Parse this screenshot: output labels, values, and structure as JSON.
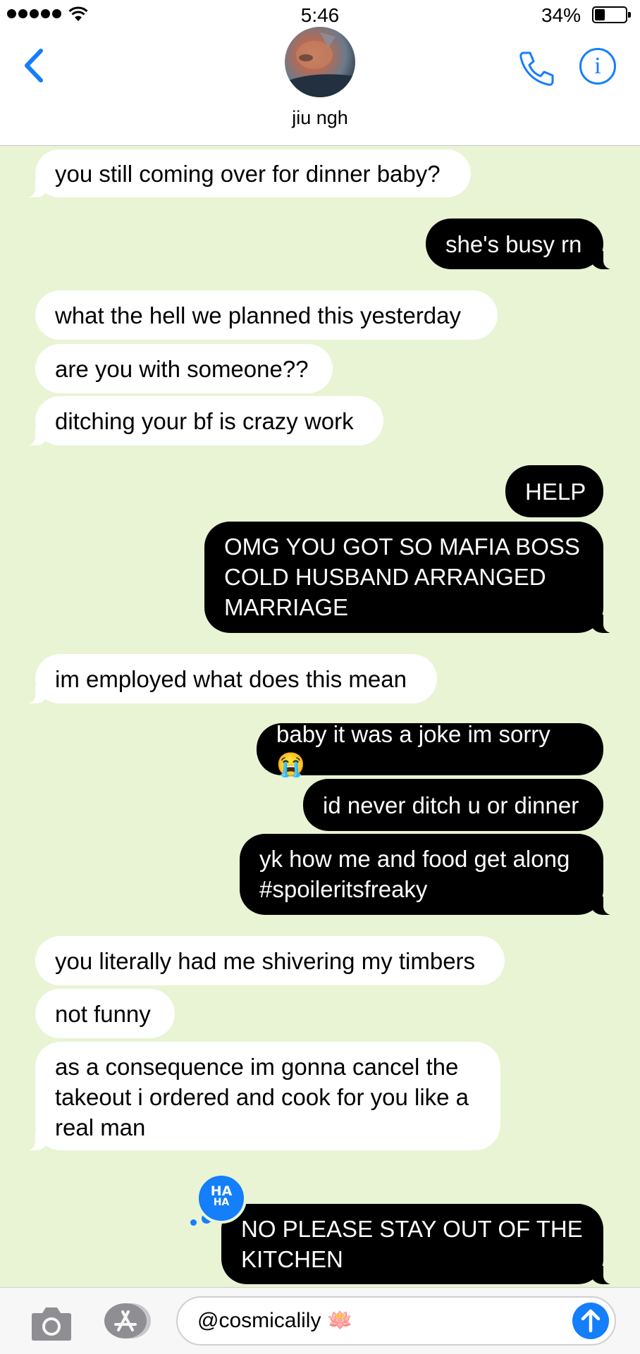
{
  "status_bar": {
    "time": "5:46",
    "battery_percent": "34%",
    "battery_level": 0.34,
    "signal_bars": 5
  },
  "header": {
    "contact_name": "jiu ngh",
    "back_icon": "chevron-left-icon",
    "call_icon": "phone-icon",
    "info_icon": "info-icon",
    "info_glyph": "i"
  },
  "messages": [
    {
      "side": "in",
      "text": "you still coming over for dinner baby?"
    },
    {
      "side": "out",
      "text": "she's busy rn"
    },
    {
      "side": "in",
      "text": "what the hell we planned this yesterday"
    },
    {
      "side": "in",
      "text": "are you with someone??"
    },
    {
      "side": "in",
      "text": "ditching your bf is crazy work"
    },
    {
      "side": "out",
      "text": "HELP"
    },
    {
      "side": "out",
      "text": "OMG YOU GOT SO MAFIA BOSS COLD HUSBAND ARRANGED MARRIAGE"
    },
    {
      "side": "in",
      "text": "im employed what does this mean"
    },
    {
      "side": "out",
      "text": "baby it was a joke im sorry 😭"
    },
    {
      "side": "out",
      "text": "id never ditch u or dinner"
    },
    {
      "side": "out",
      "text": "yk how me and food get along #spoileritsfreaky"
    },
    {
      "side": "in",
      "text": "you literally had me shivering my timbers"
    },
    {
      "side": "in",
      "text": "not funny"
    },
    {
      "side": "in",
      "text": "as a consequence im gonna cancel the takeout i ordered and cook for you like a real man"
    },
    {
      "side": "out",
      "text": "NO PLEASE STAY OUT OF THE KITCHEN",
      "tapback": {
        "line1": "HA",
        "line2": "HA"
      }
    }
  ],
  "input_bar": {
    "text": "@cosmicalily 🪷",
    "camera_icon": "camera-icon",
    "apps_icon": "app-store-icon",
    "send_icon": "send-arrow-icon"
  },
  "colors": {
    "accent": "#147efb",
    "background": "#e8f4d3",
    "incoming_bubble": "#ffffff",
    "outgoing_bubble": "#000000"
  }
}
